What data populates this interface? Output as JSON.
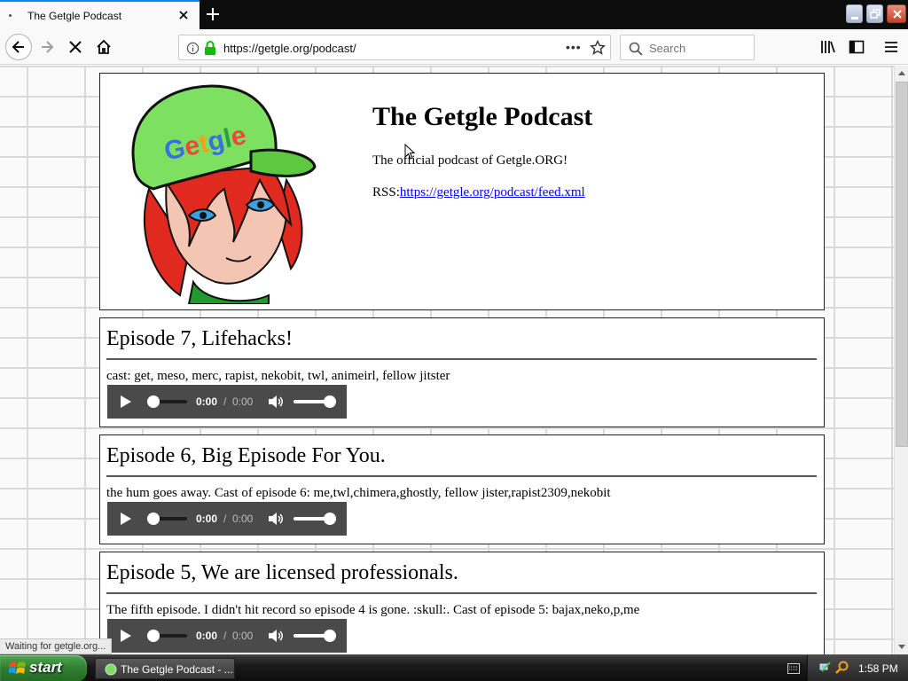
{
  "browser": {
    "tab_title": "The Getgle Podcast",
    "url": "https://getgle.org/podcast/",
    "search_placeholder": "Search",
    "status": "Waiting for getgle.org..."
  },
  "header": {
    "title": "The Getgle Podcast",
    "description": "The official podcast of Getgle.ORG!",
    "rss_label": "RSS:",
    "rss_url": "https://getgle.org/podcast/feed.xml",
    "mascot_cap_text": "Getgle"
  },
  "episodes": [
    {
      "title": "Episode 7, Lifehacks!",
      "description": "cast: get, meso, merc, rapist, nekobit, twl, animeirl, fellow jitster",
      "time_current": "0:00",
      "time_separator": "/",
      "time_duration": "0:00"
    },
    {
      "title": "Episode 6, Big Episode For You.",
      "description": "the hum goes away. Cast of episode 6: me,twl,chimera,ghostly, fellow jister,rapist2309,nekobit",
      "time_current": "0:00",
      "time_separator": "/",
      "time_duration": "0:00"
    },
    {
      "title": "Episode 5, We are licensed professionals.",
      "description": "The fifth episode. I didn't hit record so episode 4 is gone. :skull:. Cast of episode 5: bajax,neko,p,me",
      "time_current": "0:00",
      "time_separator": "/",
      "time_duration": "0:00"
    }
  ],
  "taskbar": {
    "start_label": "start",
    "task_label": "The Getgle Podcast - ...",
    "clock": "1:58 PM"
  },
  "colors": {
    "link": "#0000ee",
    "player_bg": "#4a4a4a",
    "tab_accent": "#0a84ff",
    "start_green": "#2f7d2f"
  },
  "icons": [
    "back-arrow-icon",
    "forward-arrow-icon",
    "stop-icon",
    "home-icon",
    "info-icon",
    "lock-icon",
    "star-icon",
    "search-icon",
    "library-icon",
    "sidebar-icon",
    "hamburger-menu-icon",
    "play-icon",
    "volume-icon",
    "windows-logo-icon"
  ]
}
